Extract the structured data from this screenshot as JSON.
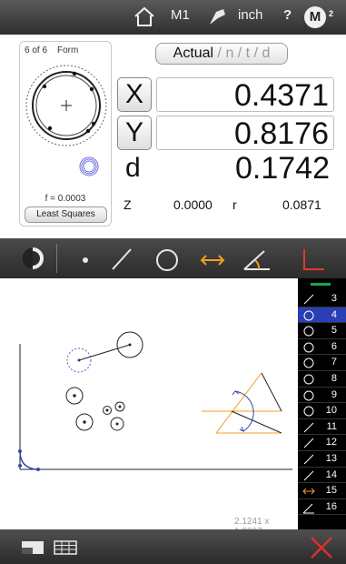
{
  "topbar": {
    "home_icon": "home-icon",
    "machine": "M1",
    "probe_icon": "probe-icon",
    "units": "inch",
    "help": "?",
    "m2_label": "M",
    "m2_sup": "2"
  },
  "feature": {
    "count": "6 of 6",
    "type": "Form",
    "form_value": "f = 0.0003",
    "method_button": "Least Squares"
  },
  "mode": {
    "active": "Actual",
    "rest": " / n / t / d"
  },
  "measure": {
    "x_label": "X",
    "x_value": "0.4371",
    "y_label": "Y",
    "y_value": "0.8176",
    "d_label": "d",
    "d_value": "0.1742",
    "z_label": "Z",
    "z_value": "0.0000",
    "r_label": "r",
    "r_value": "0.0871"
  },
  "tools": [
    "form-toggle-icon",
    "point-icon",
    "line-icon",
    "circle-icon",
    "distance-icon",
    "angle-icon",
    "datum-icon"
  ],
  "canvas": {
    "readout": "2.1241 x 1.8867"
  },
  "feature_list": [
    {
      "icon": "line",
      "num": "3",
      "selected": false
    },
    {
      "icon": "circle",
      "num": "4",
      "selected": true
    },
    {
      "icon": "circle",
      "num": "5",
      "selected": false
    },
    {
      "icon": "circle",
      "num": "6",
      "selected": false
    },
    {
      "icon": "circle",
      "num": "7",
      "selected": false
    },
    {
      "icon": "circle",
      "num": "8",
      "selected": false
    },
    {
      "icon": "circle",
      "num": "9",
      "selected": false
    },
    {
      "icon": "circle",
      "num": "10",
      "selected": false
    },
    {
      "icon": "line",
      "num": "11",
      "selected": false
    },
    {
      "icon": "line",
      "num": "12",
      "selected": false
    },
    {
      "icon": "line",
      "num": "13",
      "selected": false
    },
    {
      "icon": "line",
      "num": "14",
      "selected": false
    },
    {
      "icon": "distance",
      "num": "15",
      "selected": false
    },
    {
      "icon": "angle",
      "num": "16",
      "selected": false
    }
  ],
  "colors": {
    "accent_orange": "#f0a020",
    "select_blue": "#2a3fb3",
    "delete_red": "#e0302a",
    "green_marker": "#1aa84a"
  }
}
